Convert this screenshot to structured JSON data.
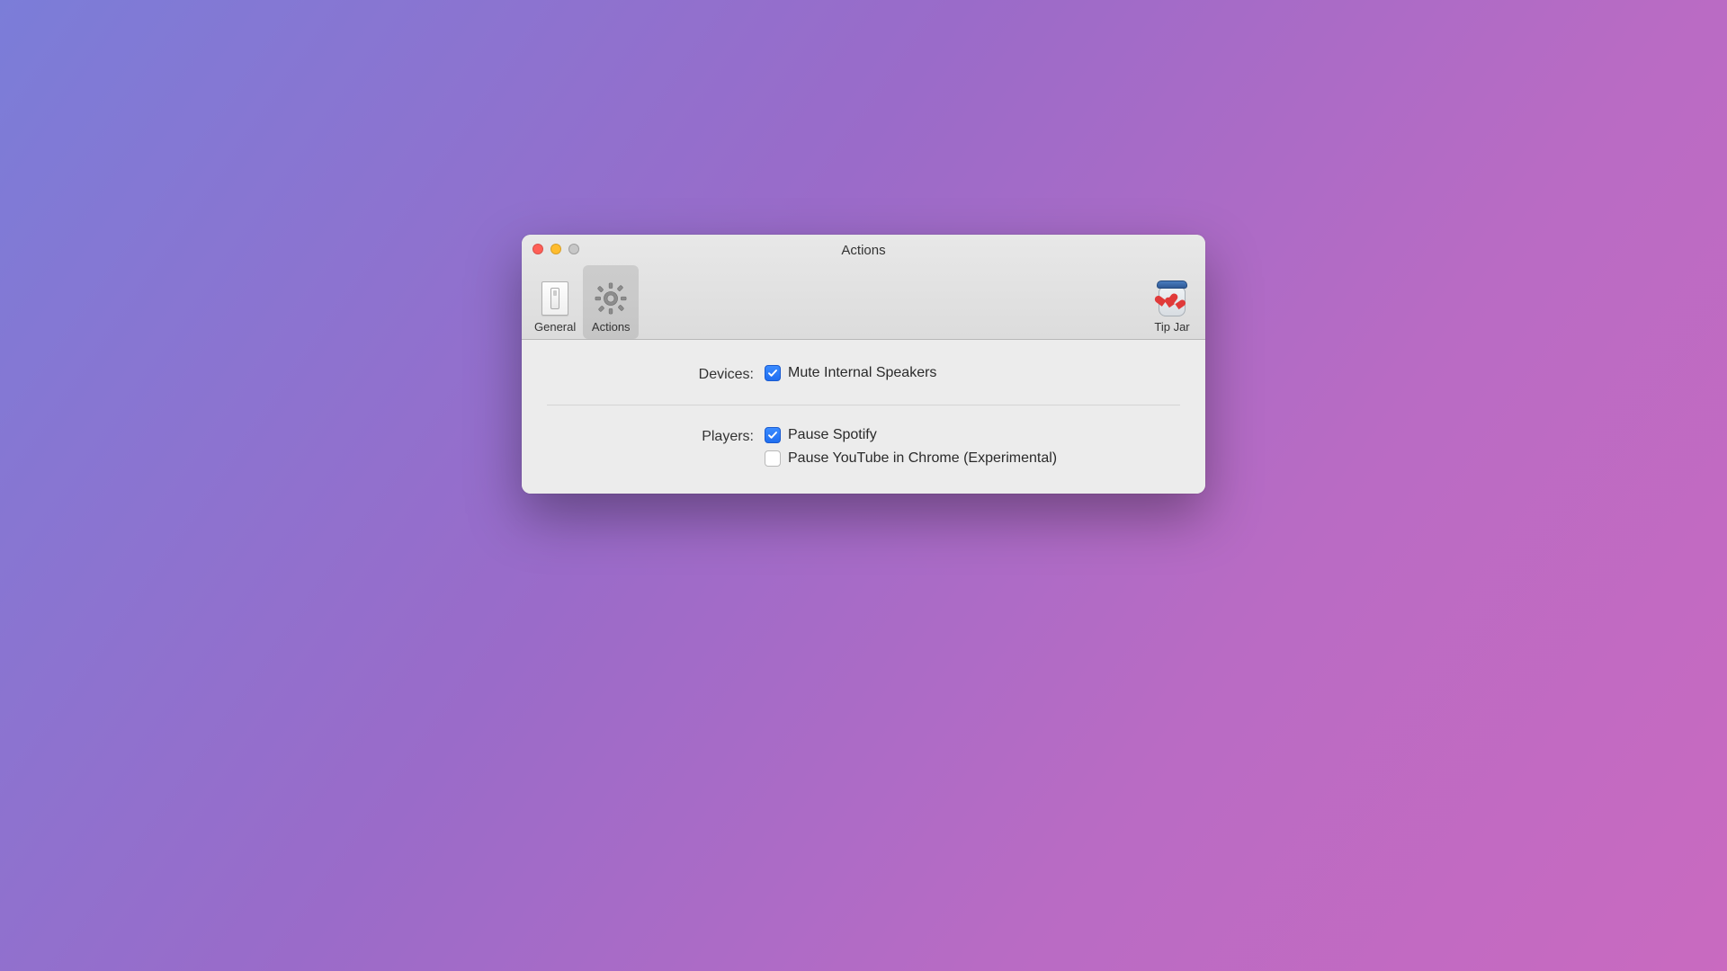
{
  "window": {
    "title": "Actions"
  },
  "toolbar": {
    "general": {
      "label": "General"
    },
    "actions": {
      "label": "Actions"
    },
    "tipjar": {
      "label": "Tip Jar"
    }
  },
  "sections": {
    "devices": {
      "label": "Devices:",
      "options": [
        {
          "label": "Mute Internal Speakers",
          "checked": true
        }
      ]
    },
    "players": {
      "label": "Players:",
      "options": [
        {
          "label": "Pause Spotify",
          "checked": true
        },
        {
          "label": "Pause YouTube in Chrome (Experimental)",
          "checked": false
        }
      ]
    }
  }
}
